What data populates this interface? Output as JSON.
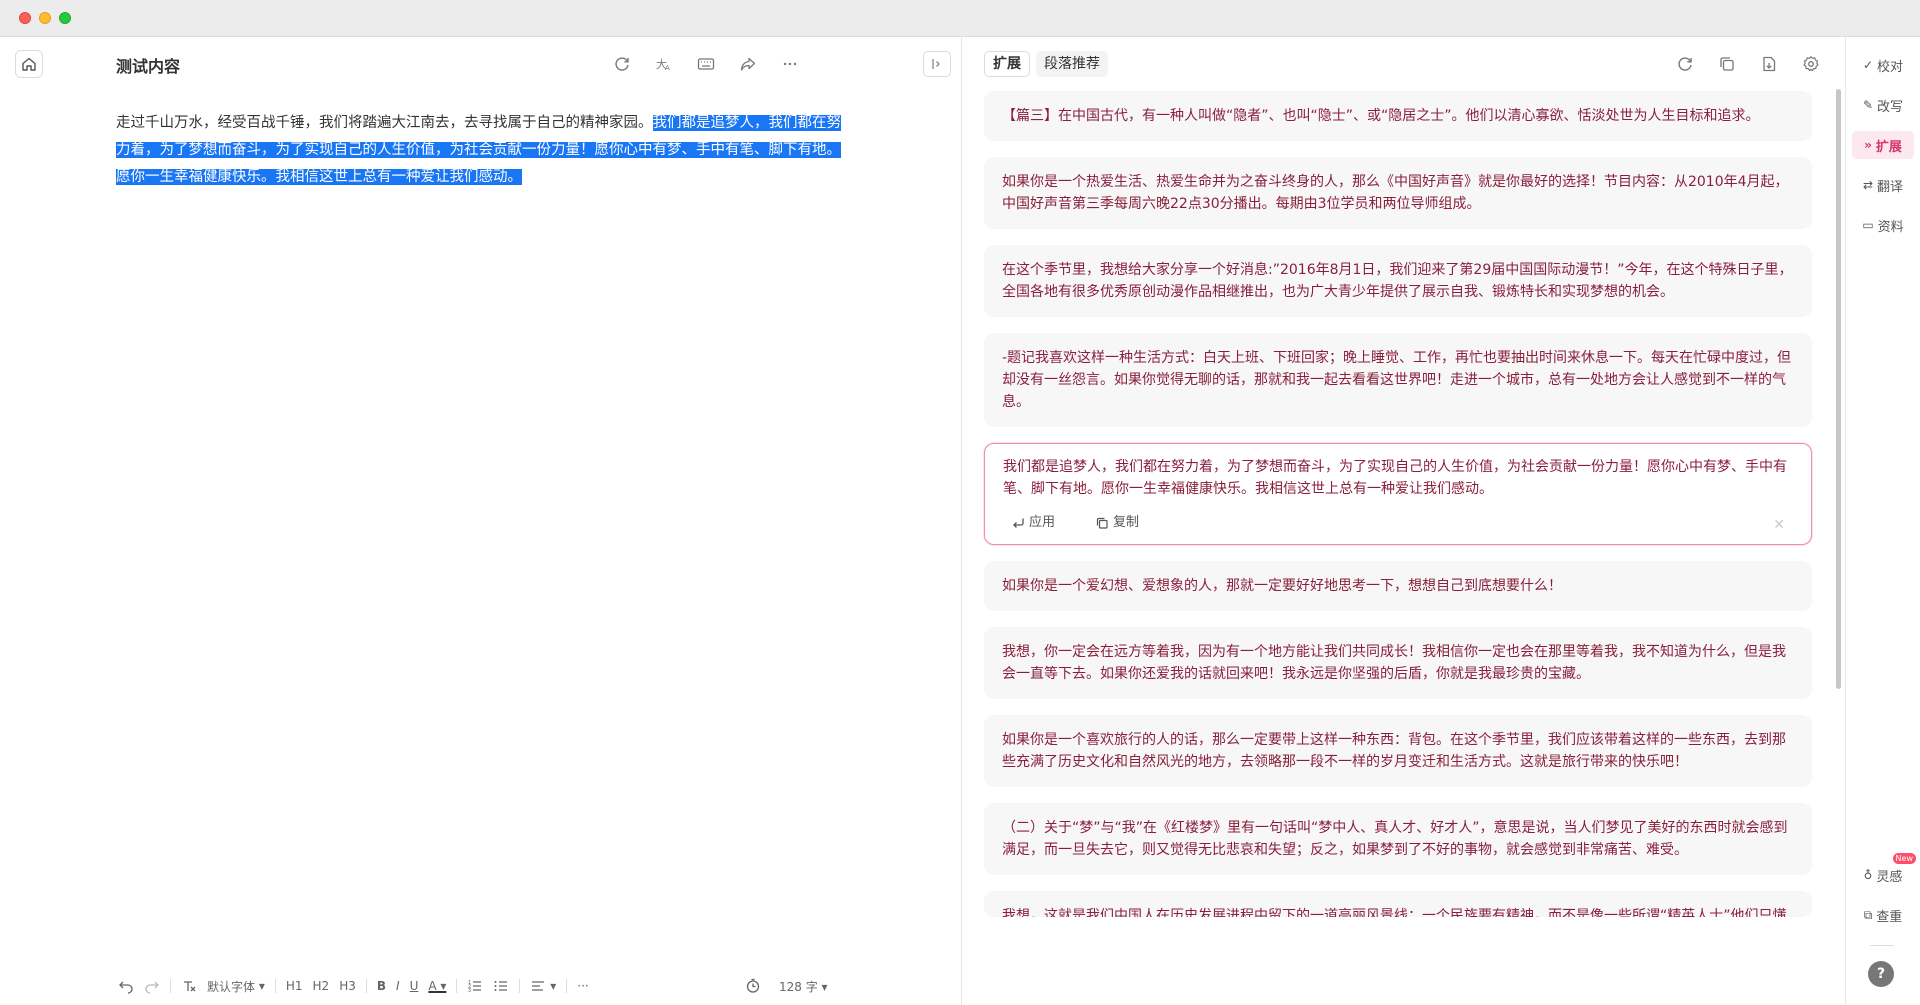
{
  "editor": {
    "title": "测试内容",
    "body_plain": "走过千山万水，经受百战千锤，我们将踏遍大江南去，去寻找属于自己的精神家园。",
    "body_selected": "我们都是追梦人，我们都在努力着，为了梦想而奋斗，为了实现自己的人生价值，为社会贡献一份力量！愿你心中有梦、手中有笔、脚下有地。愿你一生幸福健康快乐。我相信这世上总有一种爱让我们感动。",
    "tools": [
      "refresh-icon",
      "font-size-icon",
      "keyboard-icon",
      "share-icon",
      "more-icon"
    ],
    "format_bar": {
      "font": "默认字体",
      "h1": "H1",
      "h2": "H2",
      "h3": "H3",
      "bold": "B",
      "italic": "I",
      "underline": "U",
      "color": "A",
      "more": "···",
      "word_count": "128 字"
    }
  },
  "panel": {
    "tabs": [
      {
        "label": "扩展",
        "active": true
      },
      {
        "label": "段落推荐",
        "active": false
      }
    ],
    "tools": [
      "refresh-icon",
      "copy-icon",
      "export-icon",
      "settings-icon"
    ],
    "cards": [
      {
        "text": "【篇三】在中国古代，有一种人叫做“隐者”、也叫“隐士”、或“隐居之士”。他们以清心寡欲、恬淡处世为人生目标和追求。"
      },
      {
        "text": "如果你是一个热爱生活、热爱生命并为之奋斗终身的人，那么《中国好声音》就是你最好的选择！节目内容：从2010年4月起，中国好声音第三季每周六晚22点30分播出。每期由3位学员和两位导师组成。"
      },
      {
        "text": "在这个季节里，我想给大家分享一个好消息:”2016年8月1日，我们迎来了第29届中国国际动漫节！”今年，在这个特殊日子里，全国各地有很多优秀原创动漫作品相继推出，也为广大青少年提供了展示自我、锻炼特长和实现梦想的机会。"
      },
      {
        "text": "-题记我喜欢这样一种生活方式：白天上班、下班回家；晚上睡觉、工作，再忙也要抽出时间来休息一下。每天在忙碌中度过，但却没有一丝怨言。如果你觉得无聊的话，那就和我一起去看看这世界吧！走进一个城市，总有一处地方会让人感觉到不一样的气息。"
      },
      {
        "text": "我们都是追梦人，我们都在努力着，为了梦想而奋斗，为了实现自己的人生价值，为社会贡献一份力量！愿你心中有梦、手中有笔、脚下有地。愿你一生幸福健康快乐。我相信这世上总有一种爱让我们感动。",
        "focused": true,
        "apply_label": "应用",
        "copy_label": "复制"
      },
      {
        "text": "如果你是一个爱幻想、爱想象的人，那就一定要好好地思考一下，想想自己到底想要什么！"
      },
      {
        "text": "我想，你一定会在远方等着我，因为有一个地方能让我们共同成长！我相信你一定也会在那里等着我，我不知道为什么，但是我会一直等下去。如果你还爱我的话就回来吧！我永远是你坚强的后盾，你就是我最珍贵的宝藏。"
      },
      {
        "text": "如果你是一个喜欢旅行的人的话，那么一定要带上这样一种东西：背包。在这个季节里，我们应该带着这样的一些东西，去到那些充满了历史文化和自然风光的地方，去领略那一段不一样的岁月变迁和生活方式。这就是旅行带来的快乐吧！"
      },
      {
        "text": "（二）关于“梦”与“我”在《红楼梦》里有一句话叫“梦中人、真人才、好才人”，意思是说，当人们梦见了美好的东西时就会感到满足，而一旦失去它，则又觉得无比悲哀和失望；反之，如果梦到了不好的事物，就会感觉到非常痛苦、难受。"
      },
      {
        "text": "我想，这就是我们中国人在历史发展进程中留下的一道亮丽风景线：一个民族要有精神，而不是像一些所谓“精英人士”他们只懂"
      }
    ]
  },
  "rail": {
    "items": [
      {
        "label": "校对",
        "icon": "check-icon"
      },
      {
        "label": "改写",
        "icon": "rewrite-icon"
      },
      {
        "label": "扩展",
        "icon": "expand-icon",
        "active": true
      },
      {
        "label": "翻译",
        "icon": "translate-icon"
      },
      {
        "label": "资料",
        "icon": "inbox-icon"
      }
    ],
    "bottom": [
      {
        "label": "灵感",
        "icon": "bulb-icon",
        "badge": "New"
      },
      {
        "label": "查重",
        "icon": "duplicate-check-icon"
      }
    ],
    "help": "?"
  },
  "colors": {
    "selection": "#1976f5",
    "accent": "#d6336c",
    "card_text": "#8a1f3c",
    "focus_border": "#f08abf"
  }
}
